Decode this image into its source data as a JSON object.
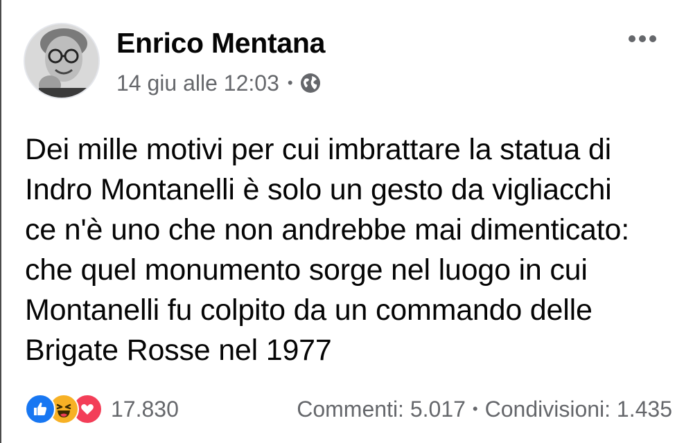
{
  "post": {
    "author": "Enrico Mentana",
    "timestamp": "14 giu alle 12:03",
    "meta_separator": "•",
    "audience_icon": "globe-icon",
    "more_icon": "more-options-icon",
    "text": "Dei mille motivi per cui imbrattare la statua di\nIndro Montanelli è solo un gesto da vigliacchi\nce n'è uno che non andrebbe mai dimenticato:\nche quel monumento sorge nel luogo in cui\nMontanelli fu colpito da un commando delle\nBrigate Rosse nel 1977"
  },
  "footer": {
    "reactions": [
      "like-icon",
      "haha-icon",
      "love-icon"
    ],
    "reaction_count": "17.830",
    "comments": "Commenti: 5.017",
    "separator": "•",
    "shares": "Condivisioni: 1.435"
  },
  "colors": {
    "like": "#1877f2",
    "haha": "#f7b125",
    "love": "#f33e58",
    "secondary_text": "#65676b",
    "primary_text": "#050505"
  }
}
